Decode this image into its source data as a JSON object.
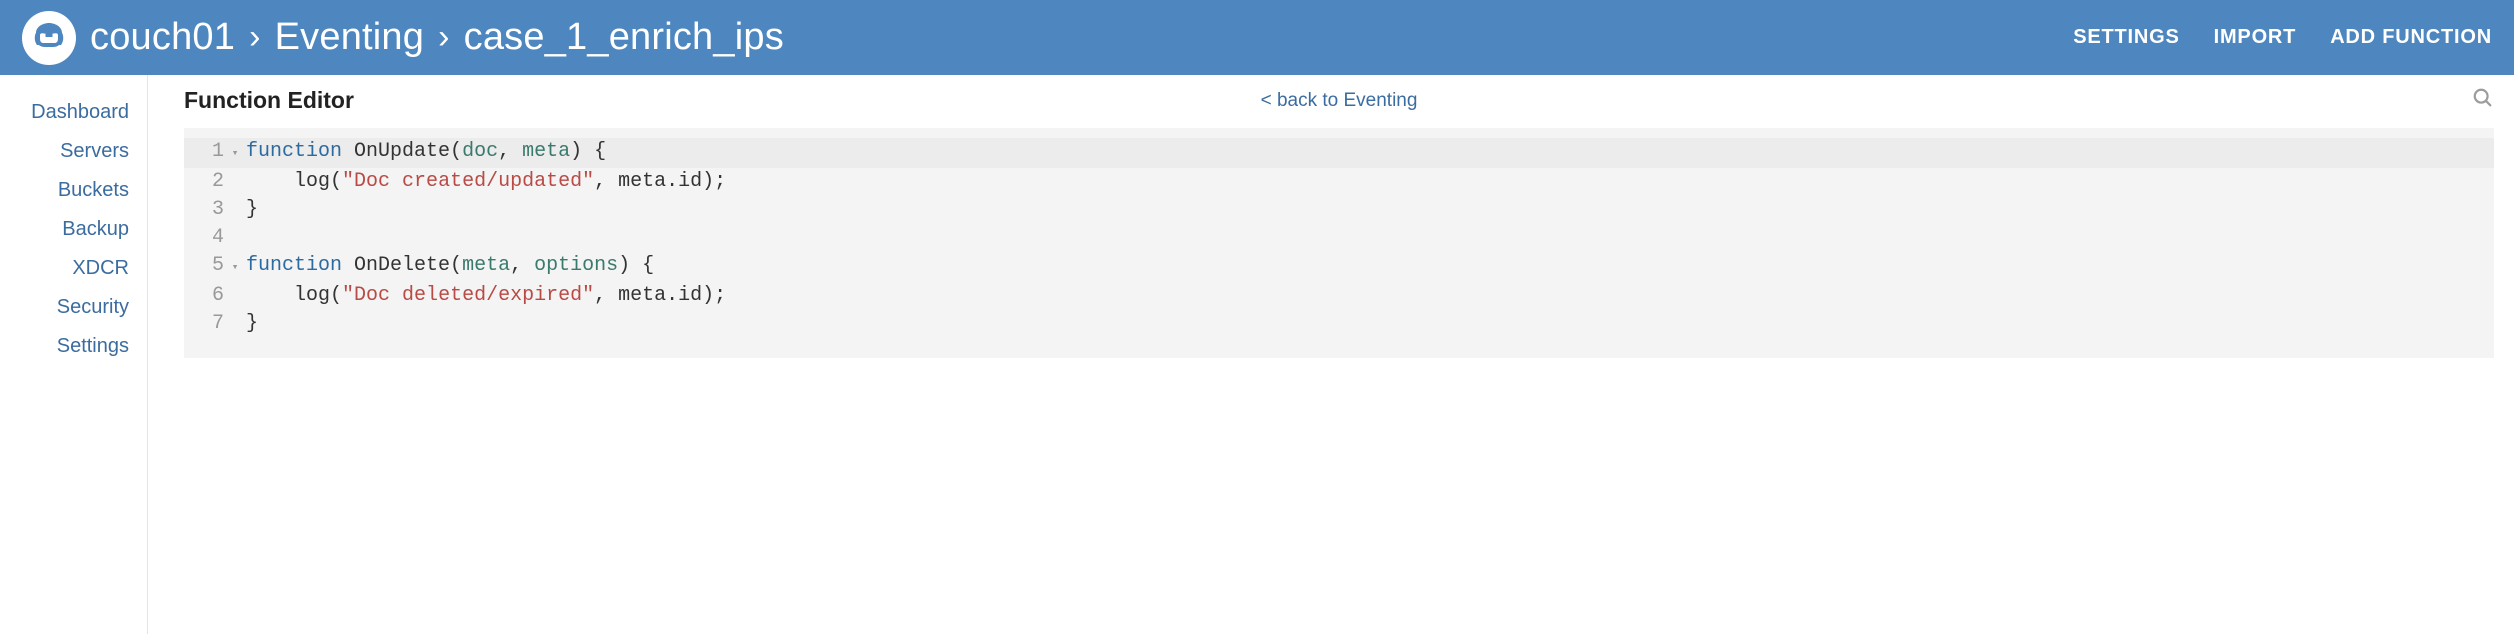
{
  "header": {
    "cluster": "couch01",
    "section": "Eventing",
    "item": "case_1_enrich_ips",
    "actions": {
      "settings": "SETTINGS",
      "import": "IMPORT",
      "add_function": "ADD FUNCTION"
    }
  },
  "sidebar": {
    "items": [
      {
        "label": "Dashboard"
      },
      {
        "label": "Servers"
      },
      {
        "label": "Buckets"
      },
      {
        "label": "Backup"
      },
      {
        "label": "XDCR"
      },
      {
        "label": "Security"
      },
      {
        "label": "Settings"
      }
    ]
  },
  "main": {
    "title": "Function Editor",
    "back_link": "< back to Eventing"
  },
  "editor": {
    "lines": [
      {
        "n": "1",
        "foldable": true
      },
      {
        "n": "2",
        "foldable": false
      },
      {
        "n": "3",
        "foldable": false
      },
      {
        "n": "4",
        "foldable": false
      },
      {
        "n": "5",
        "foldable": true
      },
      {
        "n": "6",
        "foldable": false
      },
      {
        "n": "7",
        "foldable": false
      }
    ],
    "tokens": {
      "function_kw": "function",
      "OnUpdate": "OnUpdate",
      "OnDelete": "OnDelete",
      "doc": "doc",
      "meta": "meta",
      "options": "options",
      "log": "log",
      "str_created": "\"Doc created/updated\"",
      "str_deleted": "\"Doc deleted/expired\"",
      "meta_id": "meta.id"
    }
  }
}
